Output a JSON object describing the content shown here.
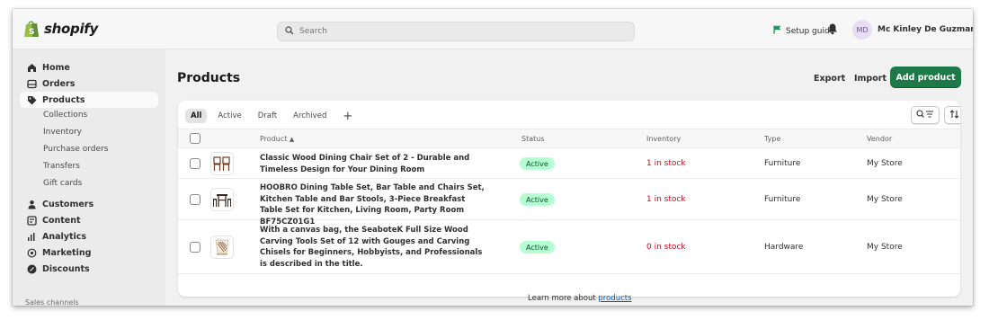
{
  "app": {
    "brand": "shopify"
  },
  "colors": {
    "primary": "#1d7a48",
    "link": "#005bd3",
    "badge_bg": "#b4fed2",
    "stock_red": "#c70a24"
  },
  "header": {
    "search_placeholder": "Search",
    "setup_guide": "Setup guide",
    "avatar_initials": "MD",
    "user_name": "Mc Kinley De Guzman"
  },
  "sidebar": {
    "items": [
      {
        "label": "Home",
        "icon": "home-icon"
      },
      {
        "label": "Orders",
        "icon": "orders-icon"
      },
      {
        "label": "Products",
        "icon": "tag-icon",
        "selected": true
      },
      {
        "label": "Customers",
        "icon": "person-icon"
      },
      {
        "label": "Content",
        "icon": "content-icon"
      },
      {
        "label": "Analytics",
        "icon": "bar-chart-icon"
      },
      {
        "label": "Marketing",
        "icon": "target-icon"
      },
      {
        "label": "Discounts",
        "icon": "discount-icon"
      }
    ],
    "product_subitems": [
      "Collections",
      "Inventory",
      "Purchase orders",
      "Transfers",
      "Gift cards"
    ],
    "sales_channels": "Sales channels"
  },
  "page": {
    "title": "Products",
    "export": "Export",
    "import": "Import",
    "add_product": "Add product"
  },
  "tabs": [
    "All",
    "Active",
    "Draft",
    "Archived"
  ],
  "table": {
    "columns": {
      "product": "Product",
      "status": "Status",
      "inventory": "Inventory",
      "type": "Type",
      "vendor": "Vendor"
    },
    "rows": [
      {
        "name": "Classic Wood Dining Chair Set of 2 - Durable and Timeless Design for Your Dining Room",
        "status": "Active",
        "inventory": "1 in stock",
        "type": "Furniture",
        "vendor": "My Store"
      },
      {
        "name": "HOOBRO Dining Table Set, Bar Table and Chairs Set, Kitchen Table and Bar Stools, 3-Piece Breakfast Table Set for Kitchen, Living Room, Party Room BF75CZ01G1",
        "status": "Active",
        "inventory": "1 in stock",
        "type": "Furniture",
        "vendor": "My Store"
      },
      {
        "name": "With a canvas bag, the SeaboteK Full Size Wood Carving Tools Set of 12 with Gouges and Carving Chisels for Beginners, Hobbyists, and Professionals is described in the title.",
        "status": "Active",
        "inventory": "0 in stock",
        "type": "Hardware",
        "vendor": "My Store"
      }
    ]
  },
  "footer": {
    "learn_prefix": "Learn more about ",
    "learn_link": "products"
  }
}
